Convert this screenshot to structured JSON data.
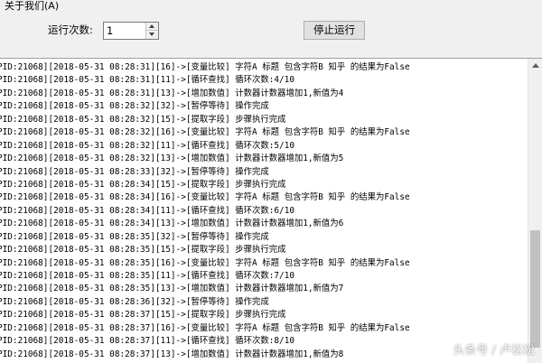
{
  "menu": {
    "about": "关于我们(A)"
  },
  "controls": {
    "runs_label": "运行次数:",
    "runs_value": "1",
    "stop_button": "停止运行"
  },
  "log": [
    "PID:21068][2018-05-31 08:28:31][16]->[变量比较] 字符A 标题 包含字符B 知乎 的结果为False",
    "PID:21068][2018-05-31 08:28:31][11]->[循环查找] 循环次数:4/10",
    "PID:21068][2018-05-31 08:28:31][13]->[增加数值] 计数器计数器增加1,新值为4",
    "PID:21068][2018-05-31 08:28:32][32]->[暂停等待] 操作完成",
    "PID:21068][2018-05-31 08:28:32][15]->[提取字段] 步骤执行完成",
    "PID:21068][2018-05-31 08:28:32][16]->[变量比较] 字符A 标题 包含字符B 知乎 的结果为False",
    "PID:21068][2018-05-31 08:28:32][11]->[循环查找] 循环次数:5/10",
    "PID:21068][2018-05-31 08:28:32][13]->[增加数值] 计数器计数器增加1,新值为5",
    "PID:21068][2018-05-31 08:28:33][32]->[暂停等待] 操作完成",
    "PID:21068][2018-05-31 08:28:34][15]->[提取字段] 步骤执行完成",
    "PID:21068][2018-05-31 08:28:34][16]->[变量比较] 字符A 标题 包含字符B 知乎 的结果为False",
    "PID:21068][2018-05-31 08:28:34][11]->[循环查找] 循环次数:6/10",
    "PID:21068][2018-05-31 08:28:34][13]->[增加数值] 计数器计数器增加1,新值为6",
    "PID:21068][2018-05-31 08:28:35][32]->[暂停等待] 操作完成",
    "PID:21068][2018-05-31 08:28:35][15]->[提取字段] 步骤执行完成",
    "PID:21068][2018-05-31 08:28:35][16]->[变量比较] 字符A 标题 包含字符B 知乎 的结果为False",
    "PID:21068][2018-05-31 08:28:35][11]->[循环查找] 循环次数:7/10",
    "PID:21068][2018-05-31 08:28:35][13]->[增加数值] 计数器计数器增加1,新值为7",
    "PID:21068][2018-05-31 08:28:36][32]->[暂停等待] 操作完成",
    "PID:21068][2018-05-31 08:28:37][15]->[提取字段] 步骤执行完成",
    "PID:21068][2018-05-31 08:28:37][16]->[变量比较] 字符A 标题 包含字符B 知乎 的结果为False",
    "PID:21068][2018-05-31 08:28:37][11]->[循环查找] 循环次数:8/10",
    "PID:21068][2018-05-31 08:28:37][13]->[增加数值] 计数器计数器增加1,新值为8"
  ],
  "watermark": "头条号 / 卢松松"
}
